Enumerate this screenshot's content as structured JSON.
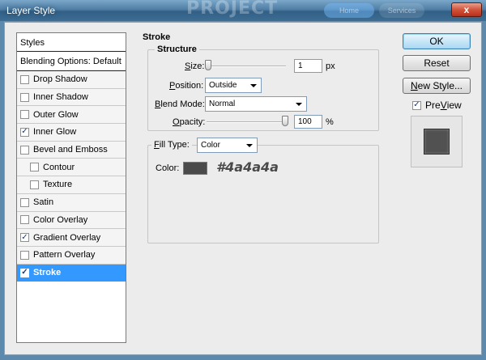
{
  "window": {
    "title": "Layer Style",
    "background_text": "PROJECT",
    "background_pill_1": "Home",
    "background_pill_2": "Services",
    "close_glyph": "x"
  },
  "styles_list": {
    "header": "Styles",
    "blending_options": "Blending Options: Default",
    "items": [
      {
        "label": "Drop Shadow",
        "checked": false
      },
      {
        "label": "Inner Shadow",
        "checked": false
      },
      {
        "label": "Outer Glow",
        "checked": false
      },
      {
        "label": "Inner Glow",
        "checked": true
      },
      {
        "label": "Bevel and Emboss",
        "checked": false
      },
      {
        "label": "Contour",
        "checked": false
      },
      {
        "label": "Texture",
        "checked": false
      },
      {
        "label": "Satin",
        "checked": false
      },
      {
        "label": "Color Overlay",
        "checked": false
      },
      {
        "label": "Gradient Overlay",
        "checked": true
      },
      {
        "label": "Pattern Overlay",
        "checked": false
      },
      {
        "label": "Stroke",
        "checked": true,
        "selected": true
      }
    ],
    "check_mark": "✓"
  },
  "stroke": {
    "section_title": "Stroke",
    "structure_title": "Structure",
    "size_label_u": "S",
    "size_label_rest": "ize:",
    "size_value": "1",
    "size_unit": "px",
    "position_label_u": "P",
    "position_label_rest": "osition:",
    "position_value": "Outside",
    "blend_mode_label_u": "B",
    "blend_mode_label_rest": "lend Mode:",
    "blend_mode_value": "Normal",
    "opacity_label_u": "O",
    "opacity_label_rest": "pacity:",
    "opacity_value": "100",
    "opacity_unit": "%",
    "fill_type_label_u": "F",
    "fill_type_label_rest": "ill Type:",
    "fill_type_value": "Color",
    "color_label": "Color:",
    "color_hex_text": "#4a4a4a",
    "color": "#4a4a4a"
  },
  "buttons": {
    "ok": "OK",
    "reset": "Reset",
    "new_style_u": "N",
    "new_style_rest": "ew Style...",
    "preview_label_u": "V",
    "preview_label_pre": "Pre",
    "preview_label_post": "iew",
    "preview_checked": true
  },
  "preview_swatch_color": "#515151"
}
